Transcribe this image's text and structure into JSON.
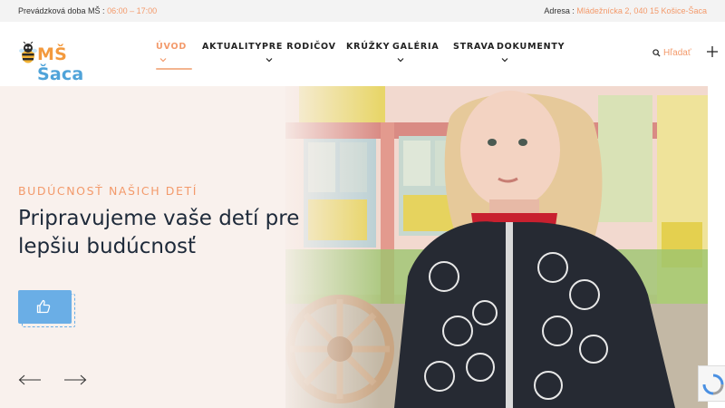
{
  "topbar": {
    "hours_label": "Prevádzková doba MŠ :",
    "hours_value": "06:00 – 17:00",
    "address_label": "Adresa :",
    "address_value": "Mládežnícka 2, 040 15 Košice-Šaca"
  },
  "logo": {
    "prefix": "MŠ",
    "name": "Šaca"
  },
  "nav": {
    "items": [
      {
        "label": "ÚVOD",
        "active": true,
        "has_dropdown": true
      },
      {
        "label": "AKTUALITY",
        "active": false,
        "has_dropdown": false
      },
      {
        "label": "PRE RODIČOV",
        "active": false,
        "has_dropdown": true
      },
      {
        "label": "KRÚŽKY",
        "active": false,
        "has_dropdown": false
      },
      {
        "label": "GALÉRIA",
        "active": false,
        "has_dropdown": true
      },
      {
        "label": "STRAVA",
        "active": false,
        "has_dropdown": false
      },
      {
        "label": "DOKUMENTY",
        "active": false,
        "has_dropdown": true
      }
    ]
  },
  "search": {
    "label": "Hľadať",
    "icon": "search-icon"
  },
  "hero": {
    "kicker": "BUDÚCNOSŤ NAŠICH DETÍ",
    "headline": "Pripravujeme vaše detí pre lepšiu budúcnosť",
    "button_icon": "thumbs-up-icon",
    "prev_icon": "arrow-left-icon",
    "next_icon": "arrow-right-icon"
  },
  "colors": {
    "accent": "#f39a6b",
    "brand_orange": "#f39a3e",
    "brand_blue": "#4fa3d9",
    "button": "#6aaee6",
    "headline": "#1e2a3a",
    "hero_bg": "#f9f1ed"
  }
}
